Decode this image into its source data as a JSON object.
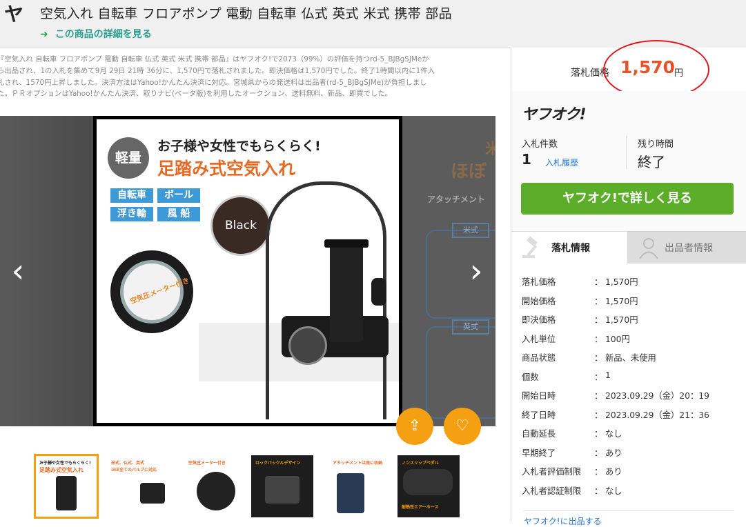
{
  "header": {
    "logo": "ヤ",
    "title": "空気入れ 自転車 フロアポンプ 電動 自転車 仏式 英式 米式 携帯 部品",
    "detail_link": "この商品の詳細を見る",
    "detail_arrow": "➜"
  },
  "description_lines": [
    "『空気入れ 自転車 フロアポンプ 電動 自転車 仏式 英式 米式 携帯 部品』はヤフオク!で2073（99%）の評価を持つrd-5_BJBgSJMeか",
    "ら出品され、1の入札を集めて9月 29日 21時 36分に、1,570円で落札されました。即決価格は1,570円でした。終了1時間以内に1件入",
    "札され、1570円上昇しました。決済方法はYahoo!かんたん決済に対応。宮城県からの発送料は出品者(rd-5_BJBgSJMe)が負担しまし",
    "た。ＰＲオプションはYahoo!かんたん決済、取りナビ(ベータ版)を利用したオークション、送料無料、新品、即買でした。"
  ],
  "gallery": {
    "main_image": {
      "badge": "軽量",
      "headline_1": "お子様や女性でもらくらく!",
      "headline_2": "足踏み式空気入れ",
      "tags": [
        "自転車",
        "ボール",
        "浮き輪",
        "風 船"
      ],
      "color_label": "Black",
      "gauge_label": "空気圧メーター付き"
    },
    "side_image_right": {
      "big_text": "ほぼ",
      "big_text_2": "米",
      "caption": "アタッチメント",
      "label_1": "米式",
      "label_2": "英式"
    },
    "prev_arrow": "‹",
    "next_arrow": "›",
    "share_icon": "⇪",
    "like_icon": "♡",
    "thumbnails": [
      {
        "line1": "お子様や女性でもらくらく!",
        "line2": "足踏み式空気入れ",
        "style": "light"
      },
      {
        "line1": "米式、仏式、英式",
        "line2": "ほぼ全てのバルブに対応",
        "style": "light"
      },
      {
        "line1": "空気圧メーター付き",
        "line2": "",
        "style": "light"
      },
      {
        "line1": "ロックバックルデザイン",
        "line2": "",
        "style": "dark"
      },
      {
        "line1": "アタッチメントは底に収納",
        "line2": "",
        "style": "light"
      },
      {
        "line1": "ノンスリップペダル",
        "line2": "耐熱性エアーホース",
        "style": "dark"
      }
    ]
  },
  "price": {
    "label": "落札価格",
    "value": "1,570",
    "unit": "円",
    "highlight_color": "#e2141c"
  },
  "card": {
    "logo": "ヤフオク!",
    "bid_count_label": "入札件数",
    "bid_count": "1",
    "bid_history_link": "入札履歴",
    "time_label": "残り時間",
    "time_value": "終了",
    "cta": "ヤフオク!で詳しく見る",
    "cta_color": "#5cae2a"
  },
  "tabs": [
    {
      "label": "落札情報",
      "icon": "gavel-icon",
      "active": true
    },
    {
      "label": "出品者情報",
      "icon": "person-icon",
      "active": false
    }
  ],
  "info_rows": [
    {
      "key": "落札価格",
      "value": "1,570円"
    },
    {
      "key": "開始価格",
      "value": "1,570円"
    },
    {
      "key": "即決価格",
      "value": "1,570円"
    },
    {
      "key": "入札単位",
      "value": "100円"
    },
    {
      "key": "商品状態",
      "value": "新品、未使用"
    },
    {
      "key": "個数",
      "value": "1"
    },
    {
      "key": "開始日時",
      "value": "2023.09.29（金）20：19"
    },
    {
      "key": "終了日時",
      "value": "2023.09.29（金）21：36"
    },
    {
      "key": "自動延長",
      "value": "なし"
    },
    {
      "key": "早期終了",
      "value": "あり"
    },
    {
      "key": "入札者評価制限",
      "value": "あり"
    },
    {
      "key": "入札者認証制限",
      "value": "なし"
    }
  ],
  "info_separator": "：",
  "sell_link": "ヤフオク!に出品する",
  "colors": {
    "accent_orange": "#f5a012",
    "price_red": "#e5542b",
    "link_blue": "#2a77c9",
    "link_teal": "#2a9d8f"
  }
}
